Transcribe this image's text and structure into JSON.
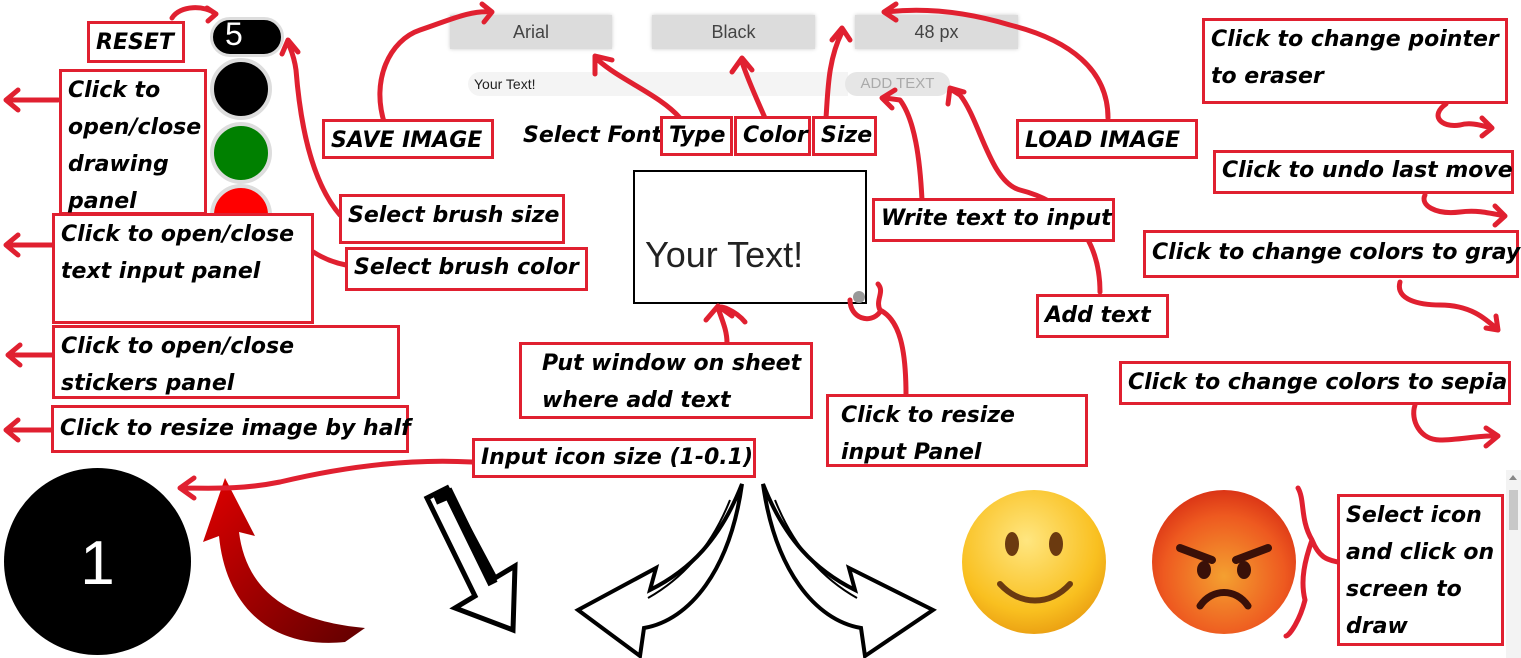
{
  "toolbar": {
    "font_button": "Arial",
    "color_button": "Black",
    "size_button": "48 px",
    "text_input_value": "Your Text!",
    "add_text_button": "ADD TEXT",
    "brush_size_value": "5"
  },
  "text_preview": "Your Text!",
  "sticker_number": "1",
  "colors": {
    "annotation_red": "#e02030",
    "brush_black": "#000000",
    "brush_green": "#008000",
    "brush_red": "#ff0000",
    "button_gray": "#dcdcdc"
  },
  "stickers": [
    "black-circle-sticker",
    "red-curved-arrow-icon",
    "sketch-down-arrow-icon",
    "sketch-left-arrow-icon",
    "sketch-right-arrow-icon",
    "smiley-emoji-icon",
    "angry-emoji-icon"
  ],
  "annotations": {
    "reset": "RESET",
    "drawing_panel": "Click to open/close drawing panel",
    "text_panel": "Click to open/close text input panel",
    "stickers_panel": "Click to open/close stickers panel",
    "resize_half": "Click to resize image by half",
    "save_image": "SAVE IMAGE",
    "select_font": "Select Font",
    "type": "Type",
    "color": "Color",
    "size": "Size",
    "load_image": "LOAD IMAGE",
    "brush_size": "Select brush size",
    "brush_color": "Select brush color",
    "write_text": "Write text to input",
    "add_text": "Add text",
    "put_window": "Put window on sheet where add text",
    "resize_input": "Click to resize input Panel",
    "icon_size": "Input icon size (1-0.1)",
    "eraser": "Click to change pointer to eraser",
    "undo": "Click to undo last move",
    "gray": "Click to change colors to gray",
    "sepia": "Click to change colors to sepia",
    "select_icon": "Select icon and click on screen to draw"
  }
}
